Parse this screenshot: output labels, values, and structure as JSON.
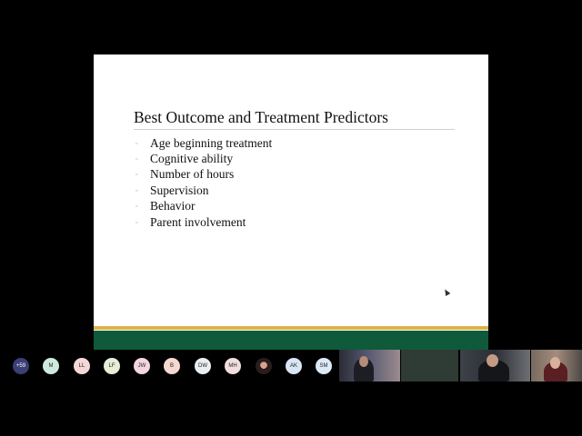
{
  "slide": {
    "title": "Best Outcome and Treatment Predictors",
    "bullets": [
      "Age beginning treatment",
      "Cognitive ability",
      "Number of hours",
      "Supervision",
      "Behavior",
      "Parent involvement"
    ],
    "bullet_glyph": "▫",
    "colors": {
      "footer_green": "#0f5a3a",
      "footer_gold": "#d9b44a"
    }
  },
  "participants": {
    "overflow_count": "+59",
    "avatars": [
      {
        "initials": "M",
        "color": "#cfe9dc"
      },
      {
        "initials": "LL",
        "color": "#f5d7d7"
      },
      {
        "initials": "LF",
        "color": "#e6eed8"
      },
      {
        "initials": "JW",
        "color": "#f2d6e0"
      },
      {
        "initials": "B",
        "color": "#f7d8d0"
      },
      {
        "initials": "DW",
        "color": "#e9eef1"
      },
      {
        "initials": "MH",
        "color": "#f1dede"
      },
      {
        "initials": "AK",
        "color": "#d9e6f6"
      },
      {
        "initials": "SM",
        "color": "#dce9f7"
      }
    ]
  }
}
